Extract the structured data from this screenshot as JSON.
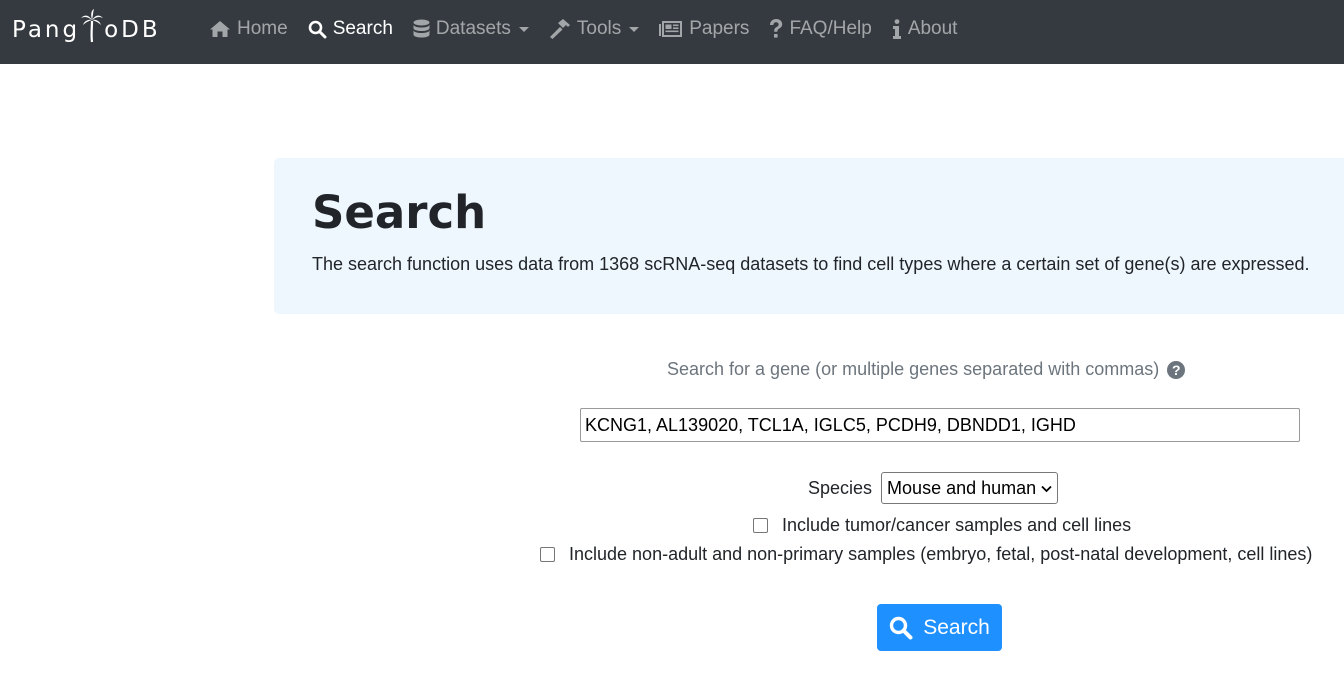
{
  "navbar": {
    "brand_left": "Pang",
    "brand_right": "oDB",
    "items": [
      {
        "label": "Home",
        "icon": "home-icon"
      },
      {
        "label": "Search",
        "icon": "search-icon"
      },
      {
        "label": "Datasets",
        "icon": "database-icon"
      },
      {
        "label": "Tools",
        "icon": "hammer-icon"
      },
      {
        "label": "Papers",
        "icon": "newspaper-icon"
      },
      {
        "label": "FAQ/Help",
        "icon": "question-icon"
      },
      {
        "label": "About",
        "icon": "info-icon"
      }
    ],
    "active": "Search"
  },
  "jumbotron": {
    "title": "Search",
    "description": "The search function uses data from 1368 scRNA-seq datasets to find cell types where a certain set of gene(s) are expressed."
  },
  "form": {
    "query_label": "Search for a gene (or multiple genes separated with commas)",
    "query_value": "KCNG1, AL139020, TCL1A, IGLC5, PCDH9, DBNDD1, IGHD",
    "species_label": "Species",
    "species_selected": "Mouse and human",
    "checkbox_tumor": "Include tumor/cancer samples and cell lines",
    "checkbox_nonadult": "Include non-adult and non-primary samples (embryo, fetal, post-natal development, cell lines)",
    "search_button": "Search"
  },
  "colors": {
    "navbar_bg": "#343a40",
    "jumbotron_bg": "#eef6fe",
    "button_bg": "#1e90ff"
  }
}
